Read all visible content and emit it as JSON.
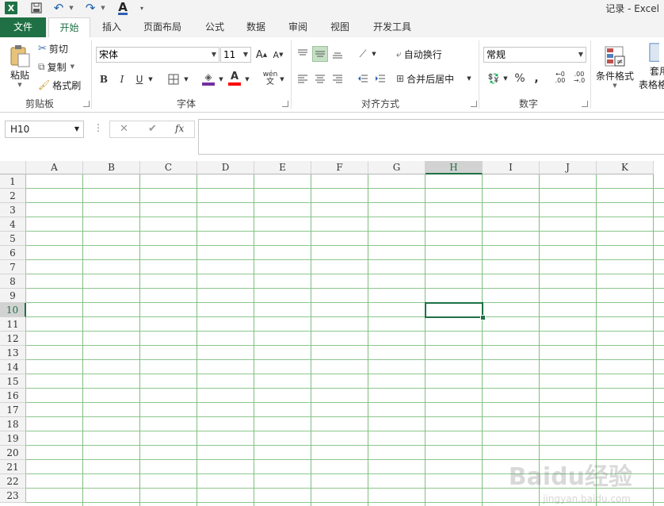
{
  "window": {
    "title": "记录 - Excel"
  },
  "quick_access": {
    "font_color_glyph": "A"
  },
  "tabs": [
    "文件",
    "开始",
    "插入",
    "页面布局",
    "公式",
    "数据",
    "审阅",
    "视图",
    "开发工具"
  ],
  "ribbon": {
    "clipboard": {
      "group": "剪贴板",
      "paste": "粘贴",
      "cut": "剪切",
      "copy": "复制",
      "format_painter": "格式刷"
    },
    "font": {
      "group": "字体",
      "font_name": "宋体",
      "font_size": "11",
      "bold": "B",
      "italic": "I",
      "underline": "U",
      "phonetic": "wén"
    },
    "alignment": {
      "group": "对齐方式",
      "wrap_text": "自动换行",
      "merge_center": "合并后居中"
    },
    "number": {
      "group": "数字",
      "format": "常规",
      "percent": "%",
      "comma": ","
    },
    "styles": {
      "conditional_format": "条件格式",
      "table_format_line1": "套用",
      "table_format_line2": "表格格"
    }
  },
  "formula_bar": {
    "name_box": "H10",
    "cancel": "✕",
    "enter": "✔",
    "fx": "fx",
    "value": ""
  },
  "sheet": {
    "columns": [
      "A",
      "B",
      "C",
      "D",
      "E",
      "F",
      "G",
      "H",
      "I",
      "J",
      "K"
    ],
    "rows": [
      "1",
      "2",
      "3",
      "4",
      "5",
      "6",
      "7",
      "8",
      "9",
      "10",
      "11",
      "12",
      "13",
      "14",
      "15",
      "16",
      "17",
      "18",
      "19",
      "20",
      "21",
      "22",
      "23"
    ],
    "selected_cell": "H10"
  },
  "watermark": {
    "main": "Baidu经验",
    "sub": "jingyan.baidu.com"
  },
  "colors": {
    "accent": "#1e7145",
    "gridline": "#8cc78c"
  }
}
